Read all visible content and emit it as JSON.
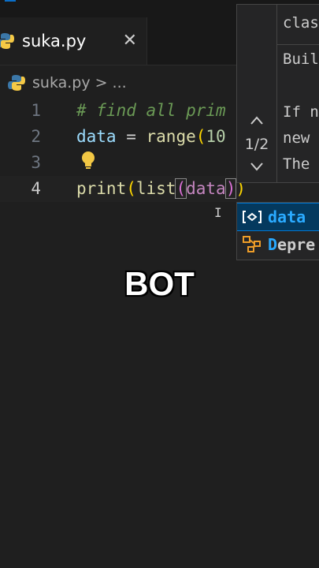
{
  "tab": {
    "filename": "suka.py",
    "close_glyph": "✕",
    "icon": "python-icon"
  },
  "breadcrumb": {
    "file": "suka.py",
    "separator": ">",
    "rest": "..."
  },
  "editor": {
    "lines": [
      {
        "number": "1",
        "text": "# find all prim"
      },
      {
        "number": "2",
        "var": "data",
        "op": " = ",
        "fn": "range",
        "paren": "(",
        "num": "10"
      },
      {
        "number": "3"
      },
      {
        "number": "4",
        "fn1": "print",
        "p1": "(",
        "fn2": "list",
        "p2": "(",
        "arg": "data",
        "p2c": ")",
        "p1c": ")"
      }
    ]
  },
  "hover": {
    "counter": "1/2",
    "signature": "clas",
    "lines": [
      "Buil",
      "",
      "If n",
      "new",
      "The"
    ]
  },
  "suggestions": [
    {
      "label": "data",
      "match": "",
      "icon": "variable-icon",
      "selected": true
    },
    {
      "label_match": "D",
      "label_rest": "epre",
      "icon": "class-icon",
      "selected": false
    }
  ],
  "overlay": {
    "text": "BOT"
  },
  "colors": {
    "background": "#1f1f1f",
    "accent": "#0078d4",
    "match": "#2aaaff"
  }
}
